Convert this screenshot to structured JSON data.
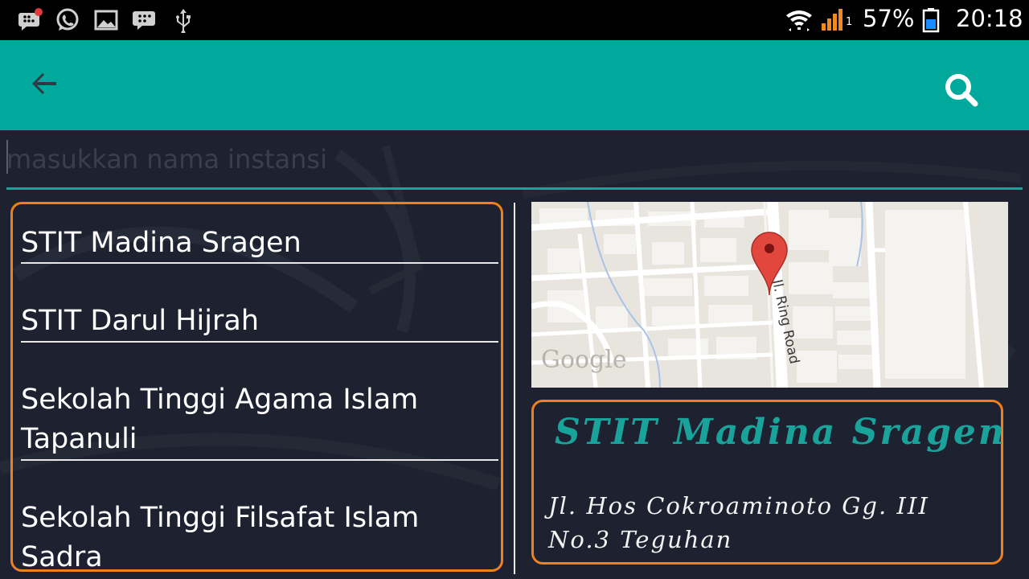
{
  "status_bar": {
    "left_icons": [
      "bbm-notification-icon",
      "whatsapp-icon",
      "gallery-icon",
      "bbm-icon",
      "usb-icon"
    ],
    "right_icons": [
      "wifi-icon",
      "signal-icon",
      "battery-icon"
    ],
    "signal_sim": "1",
    "battery_percent": "57%",
    "time": "20:18"
  },
  "app_bar": {
    "background_color": "#00a99c",
    "back_icon": "arrow-back-icon",
    "search_icon": "search-icon"
  },
  "search": {
    "placeholder": "masukkan nama instansi",
    "value": ""
  },
  "list": {
    "items": [
      {
        "label": "STIT Madina Sragen"
      },
      {
        "label": "STIT Darul Hijrah"
      },
      {
        "label": "Sekolah Tinggi Agama Islam Tapanuli"
      },
      {
        "label": "Sekolah Tinggi Filsafat Islam Sadra"
      }
    ]
  },
  "map": {
    "road_label": "Jl. Ring Road",
    "watermark": "Google",
    "marker_icon": "map-pin-icon"
  },
  "detail": {
    "title": "STIT Madina Sragen",
    "address": "Jl. Hos Cokroaminoto Gg. III No.3 Teguhan"
  },
  "colors": {
    "accent": "#00a99c",
    "highlight_border": "#f07f1d",
    "background": "#1d2130"
  }
}
